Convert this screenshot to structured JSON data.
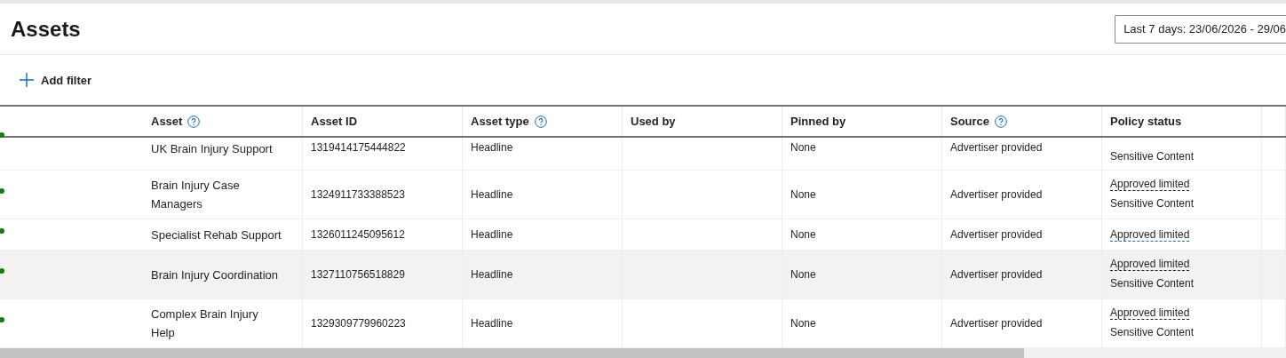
{
  "page": {
    "title": "Assets",
    "date_range": "Last 7 days: 23/06/2026 - 29/06",
    "add_filter": "Add filter"
  },
  "table": {
    "columns": [
      {
        "label": "Asset",
        "help": true
      },
      {
        "label": "Asset ID",
        "help": false
      },
      {
        "label": "Asset type",
        "help": true
      },
      {
        "label": "Used by",
        "help": false
      },
      {
        "label": "Pinned by",
        "help": false
      },
      {
        "label": "Source",
        "help": true
      },
      {
        "label": "Policy status",
        "help": false
      }
    ],
    "rows": [
      {
        "color": "#107c10",
        "asset": "UK Brain Injury Support",
        "asset_id": "1319414175444822",
        "asset_type": "Headline",
        "pinned_by": "None",
        "source": "Advertiser provided",
        "policy": [
          {
            "text": "Sensitive Content",
            "kind": "plain"
          }
        ],
        "hovered": false,
        "partial": true
      },
      {
        "color": "#107c10",
        "asset": "Brain Injury Case Managers",
        "asset_id": "1324911733388523",
        "asset_type": "Headline",
        "pinned_by": "None",
        "source": "Advertiser provided",
        "policy": [
          {
            "text": "Approved limited",
            "kind": "link",
            "focused": false
          },
          {
            "text": "Sensitive Content",
            "kind": "plain"
          }
        ],
        "hovered": false,
        "partial": false
      },
      {
        "color": "#107c10",
        "asset": "Specialist Rehab Support",
        "asset_id": "1326011245095612",
        "asset_type": "Headline",
        "pinned_by": "None",
        "source": "Advertiser provided",
        "policy": [
          {
            "text": "Approved limited",
            "kind": "link",
            "focused": true
          }
        ],
        "hovered": false,
        "partial": false
      },
      {
        "color": "#107c10",
        "asset": "Brain Injury Coordination",
        "asset_id": "1327110756518829",
        "asset_type": "Headline",
        "pinned_by": "None",
        "source": "Advertiser provided",
        "policy": [
          {
            "text": "Approved limited",
            "kind": "link",
            "focused": false
          },
          {
            "text": "Sensitive Content",
            "kind": "plain"
          }
        ],
        "hovered": true,
        "partial": false
      },
      {
        "color": "#107c10",
        "asset": "Complex Brain Injury Help",
        "asset_id": "1329309779960223",
        "asset_type": "Headline",
        "pinned_by": "None",
        "source": "Advertiser provided",
        "policy": [
          {
            "text": "Approved limited",
            "kind": "link",
            "focused": false
          },
          {
            "text": "Sensitive Content",
            "kind": "plain"
          }
        ],
        "hovered": false,
        "partial": false
      }
    ]
  }
}
